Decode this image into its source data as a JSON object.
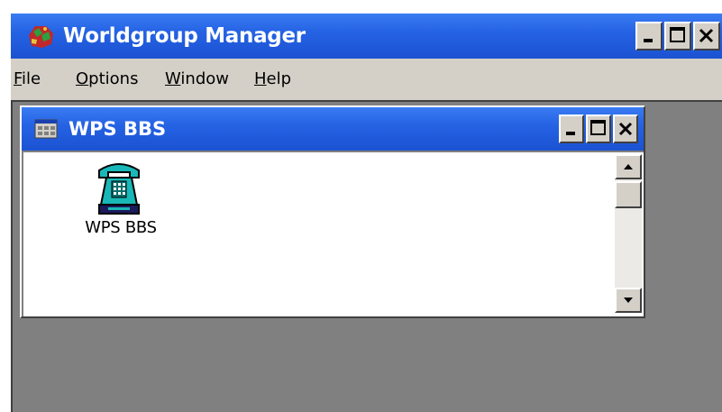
{
  "window": {
    "title": "Worldgroup Manager",
    "icon": "worldgroup-app-icon",
    "accent_color": "#2563e4"
  },
  "menu": [
    {
      "label": "File",
      "underline": "F",
      "rest": "ile"
    },
    {
      "label": "Options",
      "underline": "O",
      "rest": "ptions"
    },
    {
      "label": "Window",
      "underline": "W",
      "rest": "indow"
    },
    {
      "label": "Help",
      "underline": "H",
      "rest": "elp"
    }
  ],
  "child_window": {
    "title": "WPS BBS",
    "icon": "bbs-window-icon",
    "items": [
      {
        "label": "WPS BBS",
        "icon": "telephone-icon"
      }
    ]
  },
  "colors": {
    "titlebar": "#2563e4",
    "workspace": "#808080",
    "face": "#d4d0c8",
    "phone": "#19b7b7"
  }
}
